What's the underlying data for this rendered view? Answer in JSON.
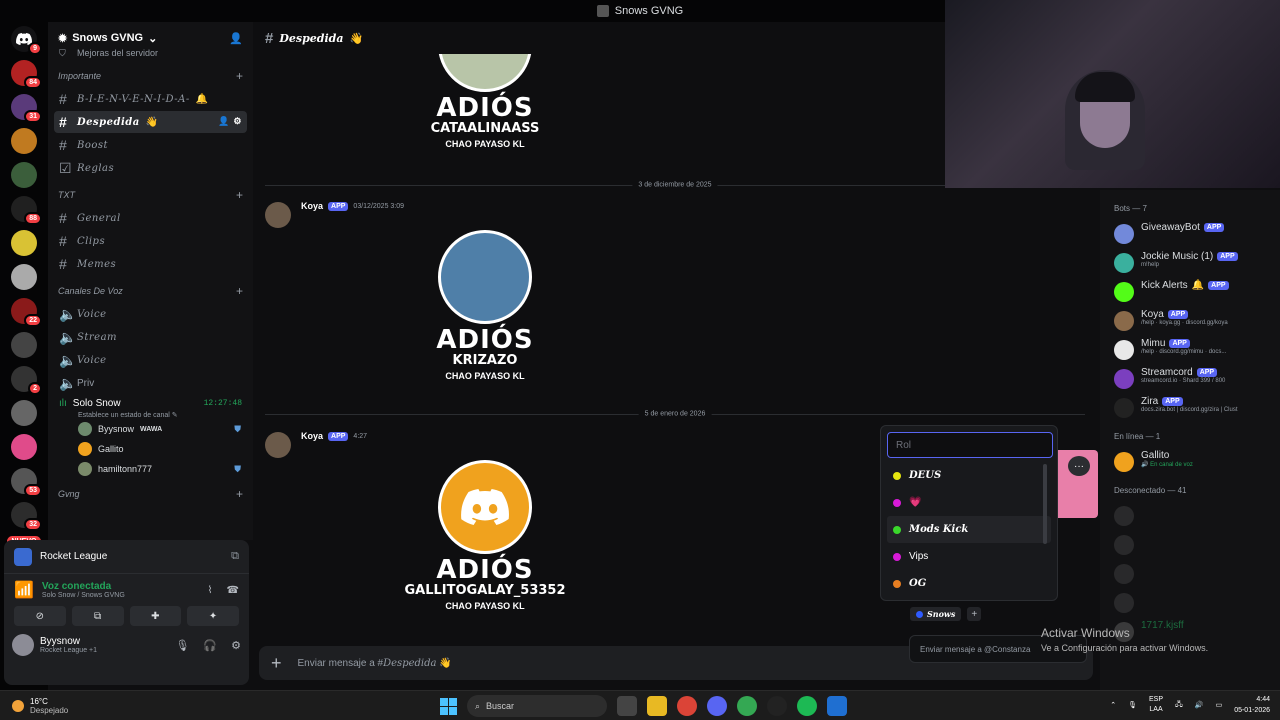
{
  "window": {
    "title": "Snows GVNG"
  },
  "rail": {
    "servers": [
      {
        "badge": "9"
      },
      {
        "badge": "84"
      },
      {
        "badge": "31"
      },
      {
        "badge": ""
      },
      {
        "badge": ""
      },
      {
        "badge": "88"
      },
      {
        "badge": ""
      },
      {
        "badge": ""
      },
      {
        "badge": "22"
      },
      {
        "badge": ""
      },
      {
        "badge": "2"
      },
      {
        "badge": ""
      },
      {
        "badge": ""
      },
      {
        "badge": "53"
      },
      {
        "badge": "32"
      }
    ],
    "new_label": "NUEVO",
    "colors": {
      "badge": "#f23f43"
    }
  },
  "sidebar": {
    "server_name": "Snows GVNG",
    "boost_row": "Mejoras del servidor",
    "categories": {
      "importante": "Importante",
      "txt": "TXT",
      "voz": "Canales De Voz",
      "gvng": "Gvng"
    },
    "channels": {
      "bienvenida": "B-I-E-N-V-E-N-I-D-A-",
      "despedida": "Despedida",
      "boost": "Boost",
      "reglas": "Reglas",
      "general": "General",
      "clips": "Clips",
      "memes": "Memes",
      "voice1": "Voice",
      "stream": "Stream",
      "voice2": "Voice",
      "priv": "Priv"
    },
    "solo_snow": {
      "name": "Solo Snow",
      "timer": "12:27:48",
      "status_note": "Establece un estado de canal",
      "users": [
        {
          "name": "Byysnow",
          "tag": "WAWA"
        },
        {
          "name": "Gallito",
          "tag": ""
        },
        {
          "name": "hamiltonn777",
          "tag": ""
        }
      ]
    }
  },
  "userpanel": {
    "activity": "Rocket League",
    "voice_status": "Voz conectada",
    "voice_location": "Solo Snow / Snows GVNG",
    "user": "Byysnow",
    "user_activity": "Rocket League +1"
  },
  "main": {
    "channel": "Despedida",
    "messages": [
      {
        "username": "CATAALINAASS",
        "adios": "ADIÓS",
        "sub": "CHAO PAYASO KL"
      },
      {
        "author": "Koya",
        "tag": "APP",
        "time": "03/12/2025 3:09",
        "adios": "ADIÓS",
        "username": "KRIZAZO",
        "sub": "CHAO PAYASO KL"
      },
      {
        "author": "Koya",
        "tag": "APP",
        "time": "4:27",
        "adios": "ADIÓS",
        "username": "GALLITOGALAY_53352",
        "sub": "CHAO PAYASO KL"
      }
    ],
    "dividers": [
      "3 de diciembre de 2025",
      "5 de enero de 2026"
    ],
    "composer_prefix": "Enviar mensaje a #",
    "composer_channel": "Despedida"
  },
  "role_picker": {
    "placeholder": "Rol",
    "roles": [
      {
        "name": "DEUS",
        "color": "#e5e510"
      },
      {
        "name": "",
        "color": "#d81ad8"
      },
      {
        "name": "Mods Kick",
        "color": "#3ad82b"
      },
      {
        "name": "Vips",
        "color": "#d81ad8"
      },
      {
        "name": "OG",
        "color": "#e67e22"
      }
    ],
    "assigned_role": "Snows",
    "dm_placeholder": "Enviar mensaje a @Constanza"
  },
  "members": {
    "groups": {
      "bots": "Bots — 7",
      "online": "En línea — 1",
      "offline": "Desconectado — 41"
    },
    "bots": [
      {
        "name": "GiveawayBot",
        "status": ""
      },
      {
        "name": "Jockie Music (1)",
        "status": "m!help"
      },
      {
        "name": "Kick Alerts",
        "status": ""
      },
      {
        "name": "Koya",
        "status": "/help · koya.gg · discord.gg/koya"
      },
      {
        "name": "Mimu",
        "status": "/help · discord.gg/mimu · docs..."
      },
      {
        "name": "Streamcord",
        "status": "streamcord.io · Shard 399 / 800"
      },
      {
        "name": "Zira",
        "status": "docs.zira.bot | discord.gg/zira | Clust"
      }
    ],
    "online": [
      {
        "name": "Gallito",
        "status": "En canal de voz"
      }
    ],
    "offline": [
      "",
      "",
      "",
      "",
      "1717.kjsff"
    ]
  },
  "watermark": {
    "line1": "Activar Windows",
    "line2": "Ve a Configuración para activar Windows."
  },
  "taskbar": {
    "temp": "16°C",
    "weather": "Despejado",
    "search": "Buscar",
    "lang1": "ESP",
    "lang2": "LAA",
    "time": "4:44",
    "date": "05-01-2026"
  },
  "colors": {
    "accent": "#5865f2",
    "online": "#23a55a",
    "danger": "#f23f43"
  }
}
